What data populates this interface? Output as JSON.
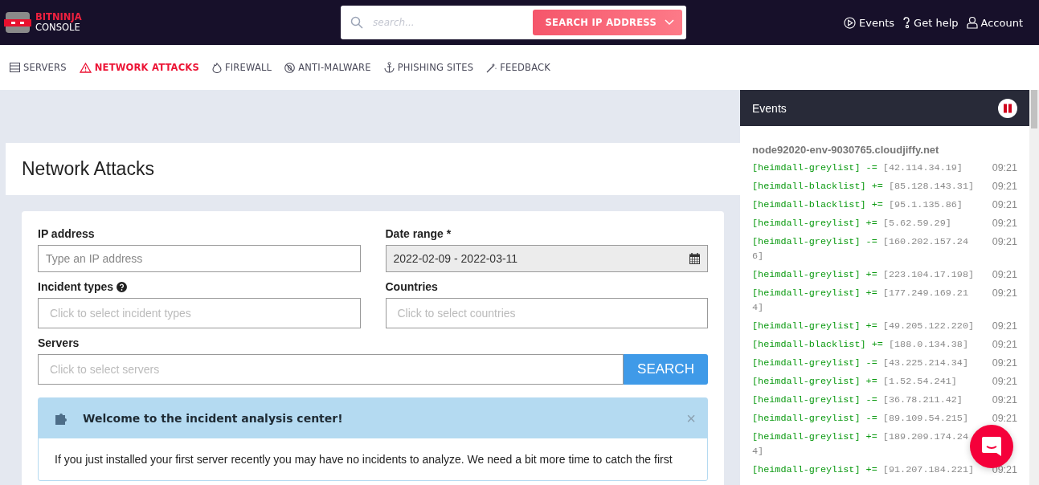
{
  "brand": {
    "name": "BITNINJA",
    "subtitle": "CONSOLE"
  },
  "search": {
    "placeholder": "search...",
    "button": "SEARCH IP ADDRESS"
  },
  "top_links": [
    {
      "label": "Events"
    },
    {
      "label": "Get help"
    },
    {
      "label": "Account"
    }
  ],
  "nav": [
    {
      "label": "SERVERS",
      "selected": false
    },
    {
      "label": "NETWORK ATTACKS",
      "selected": true
    },
    {
      "label": "FIREWALL",
      "selected": false
    },
    {
      "label": "ANTI-MALWARE",
      "selected": false
    },
    {
      "label": "PHISHING SITES",
      "selected": false
    },
    {
      "label": "FEEDBACK",
      "selected": false
    }
  ],
  "page_title": "Network Attacks",
  "form": {
    "ip": {
      "label": "IP address",
      "placeholder": "Type an IP address"
    },
    "date_range": {
      "label": "Date range *",
      "value": "2022-02-09 - 2022-03-11"
    },
    "incident_types": {
      "label": "Incident types",
      "placeholder": "Click to select incident types"
    },
    "countries": {
      "label": "Countries",
      "placeholder": "Click to select countries"
    },
    "servers": {
      "label": "Servers",
      "placeholder": "Click to select servers"
    },
    "search_button": "SEARCH"
  },
  "alert": {
    "title": "Welcome to the incident analysis center!",
    "close": "×",
    "body": "If you just installed your first server recently you may have no incidents to analyze. We need a bit more time to catch the first"
  },
  "events": {
    "title": "Events",
    "host": "node92020-env-9030765.cloudjiffy.net",
    "items": [
      {
        "tag": "[heimdall-greylist]",
        "op": "-=",
        "ip": "[42.114.34.19]",
        "time": "09:21"
      },
      {
        "tag": "[heimdall-blacklist]",
        "op": "+=",
        "ip": "[85.128.143.31]",
        "time": "09:21"
      },
      {
        "tag": "[heimdall-blacklist]",
        "op": "+=",
        "ip": "[95.1.135.86]",
        "time": "09:21"
      },
      {
        "tag": "[heimdall-greylist]",
        "op": "+=",
        "ip": "[5.62.59.29]",
        "time": "09:21"
      },
      {
        "tag": "[heimdall-greylist]",
        "op": "-=",
        "ip": "[160.202.157.246]",
        "time": "09:21"
      },
      {
        "tag": "[heimdall-greylist]",
        "op": "+=",
        "ip": "[223.104.17.198]",
        "time": "09:21"
      },
      {
        "tag": "[heimdall-greylist]",
        "op": "+=",
        "ip": "[177.249.169.214]",
        "time": "09:21"
      },
      {
        "tag": "[heimdall-greylist]",
        "op": "+=",
        "ip": "[49.205.122.220]",
        "time": "09:21"
      },
      {
        "tag": "[heimdall-blacklist]",
        "op": "+=",
        "ip": "[188.0.134.38]",
        "time": "09:21"
      },
      {
        "tag": "[heimdall-greylist]",
        "op": "-=",
        "ip": "[43.225.214.34]",
        "time": "09:21"
      },
      {
        "tag": "[heimdall-greylist]",
        "op": "+=",
        "ip": "[1.52.54.241]",
        "time": "09:21"
      },
      {
        "tag": "[heimdall-greylist]",
        "op": "-=",
        "ip": "[36.78.211.42]",
        "time": "09:21"
      },
      {
        "tag": "[heimdall-greylist]",
        "op": "-=",
        "ip": "[89.109.54.215]",
        "time": "09:21"
      },
      {
        "tag": "[heimdall-greylist]",
        "op": "+=",
        "ip": "[189.209.174.244]"
      },
      {
        "tag": "[heimdall-greylist]",
        "op": "+=",
        "ip": "[91.207.184.221]",
        "time": "09:21"
      }
    ]
  }
}
